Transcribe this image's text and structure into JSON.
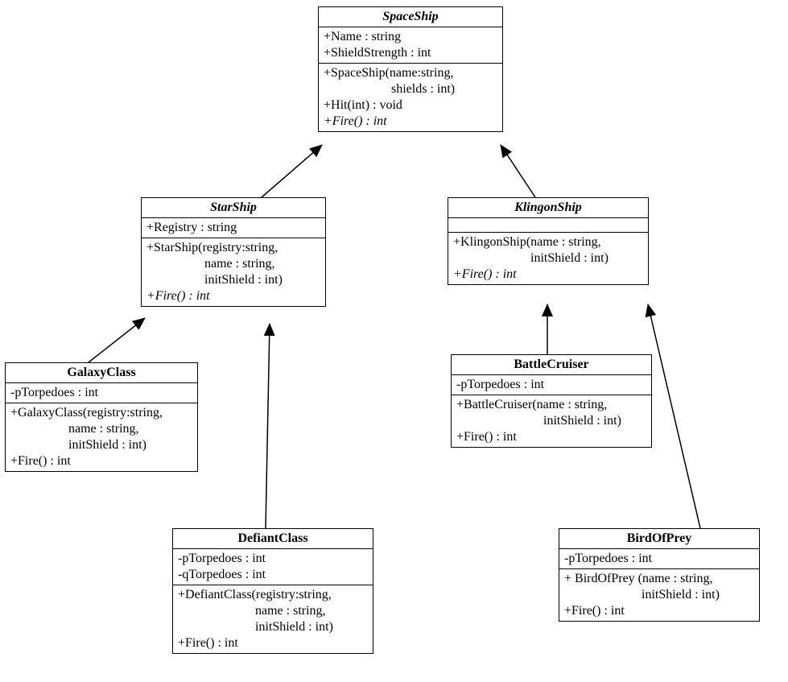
{
  "classes": {
    "SpaceShip": {
      "name": "SpaceShip",
      "abstract": true,
      "attributes": [
        "+Name : string",
        "+ShieldStrength : int"
      ],
      "methods": [
        "+SpaceShip(name:string,",
        "                     shields : int)",
        "+Hit(int) : void"
      ],
      "abstractMethods": [
        "+Fire() : int"
      ]
    },
    "StarShip": {
      "name": "StarShip",
      "abstract": true,
      "attributes": [
        "+Registry : string"
      ],
      "methods": [
        "+StarShip(registry:string,",
        "                  name : string,",
        "                  initShield : int)"
      ],
      "abstractMethods": [
        "+Fire() : int"
      ]
    },
    "KlingonShip": {
      "name": "KlingonShip",
      "abstract": true,
      "attributes": [],
      "methods": [
        "+KlingonShip(name : string,",
        "                        initShield : int)"
      ],
      "abstractMethods": [
        "+Fire() : int"
      ]
    },
    "GalaxyClass": {
      "name": "GalaxyClass",
      "abstract": false,
      "attributes": [
        "-pTorpedoes : int"
      ],
      "methods": [
        "+GalaxyClass(registry:string,",
        "                  name : string,",
        "                  initShield : int)",
        "+Fire() : int"
      ],
      "abstractMethods": []
    },
    "BattleCruiser": {
      "name": "BattleCruiser",
      "abstract": false,
      "attributes": [
        "-pTorpedoes : int"
      ],
      "methods": [
        "+BattleCruiser(name : string,",
        "                           initShield : int)",
        "+Fire() : int"
      ],
      "abstractMethods": []
    },
    "DefiantClass": {
      "name": "DefiantClass",
      "abstract": false,
      "attributes": [
        "-pTorpedoes : int",
        "-qTorpedoes : int"
      ],
      "methods": [
        "+DefiantClass(registry:string,",
        "                        name : string,",
        "                        initShield : int)",
        "+Fire() : int"
      ],
      "abstractMethods": []
    },
    "BirdOfPrey": {
      "name": "BirdOfPrey",
      "abstract": false,
      "attributes": [
        "-pTorpedoes : int"
      ],
      "methods": [
        "+ BirdOfPrey (name : string,",
        "                        initShield : int)",
        "+Fire() : int"
      ],
      "abstractMethods": []
    }
  },
  "edges": [
    {
      "from": "StarShip",
      "to": "SpaceShip"
    },
    {
      "from": "KlingonShip",
      "to": "SpaceShip"
    },
    {
      "from": "GalaxyClass",
      "to": "StarShip"
    },
    {
      "from": "DefiantClass",
      "to": "StarShip"
    },
    {
      "from": "BattleCruiser",
      "to": "KlingonShip"
    },
    {
      "from": "BirdOfPrey",
      "to": "KlingonShip"
    }
  ]
}
